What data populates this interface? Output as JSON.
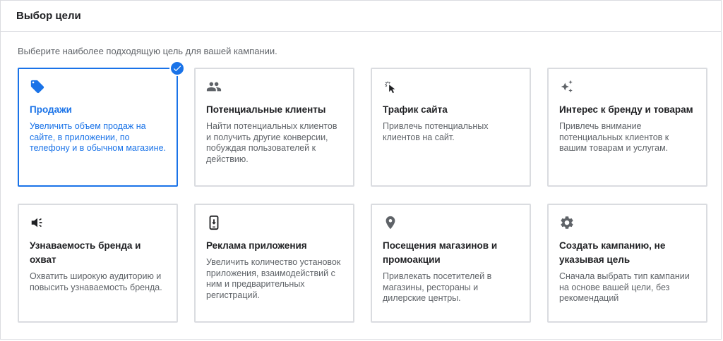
{
  "header": {
    "title": "Выбор цели"
  },
  "subtitle": "Выберите наиболее подходящую цель для вашей кампании.",
  "colors": {
    "accent": "#1a73e8",
    "icon": "#5f6368",
    "border": "#dadce0"
  },
  "cards": [
    {
      "icon": "tag-icon",
      "title": "Продажи",
      "description": "Увеличить объем продаж на сайте, в приложении, по телефону и в обычном магазине.",
      "selected": true
    },
    {
      "icon": "people-icon",
      "title": "Потенциальные клиенты",
      "description": "Найти потенциальных клиентов и получить другие конверсии, побуждая пользователей к действию.",
      "selected": false
    },
    {
      "icon": "cursor-click-icon",
      "title": "Трафик сайта",
      "description": "Привлечь потенциальных клиентов на сайт.",
      "selected": false
    },
    {
      "icon": "sparkle-icon",
      "title": "Интерес к бренду и товарам",
      "description": "Привлечь внимание потенциальных клиентов к вашим товарам и услугам.",
      "selected": false
    },
    {
      "icon": "megaphone-icon",
      "title": "Узнаваемость бренда и охват",
      "description": "Охватить широкую аудиторию и повысить узнаваемость бренда.",
      "selected": false
    },
    {
      "icon": "phone-download-icon",
      "title": "Реклама приложения",
      "description": "Увеличить количество установок приложения, взаимодействий с ним и предварительных регистраций.",
      "selected": false
    },
    {
      "icon": "location-pin-icon",
      "title": "Посещения магазинов и промоакции",
      "description": "Привлекать посетителей в магазины, рестораны и дилерские центры.",
      "selected": false
    },
    {
      "icon": "gear-icon",
      "title": "Создать кампанию, не указывая цель",
      "description": "Сначала выбрать тип кампании на основе вашей цели, без рекомендаций",
      "selected": false
    }
  ]
}
